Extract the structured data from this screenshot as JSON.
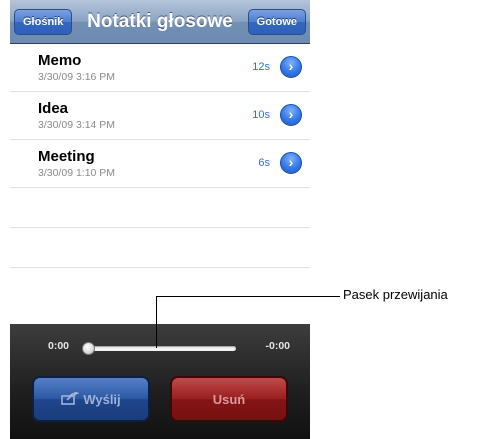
{
  "navbar": {
    "left_button": "Głośnik",
    "title": "Notatki głosowe",
    "right_button": "Gotowe"
  },
  "recordings": [
    {
      "title": "Memo",
      "date": "3/30/09 3:16 PM",
      "duration": "12s"
    },
    {
      "title": "Idea",
      "date": "3/30/09 3:14 PM",
      "duration": "10s"
    },
    {
      "title": "Meeting",
      "date": "3/30/09 1:10 PM",
      "duration": "6s"
    }
  ],
  "player": {
    "time_elapsed": "0:00",
    "time_remaining": "-0:00",
    "progress": 0.0,
    "share_label": "Wyślij",
    "delete_label": "Usuń"
  },
  "callout": {
    "label": "Pasek przewijania"
  },
  "colors": {
    "accent": "#3378e5",
    "duration_text": "#3a6ad0",
    "delete": "#9a1f1f"
  }
}
